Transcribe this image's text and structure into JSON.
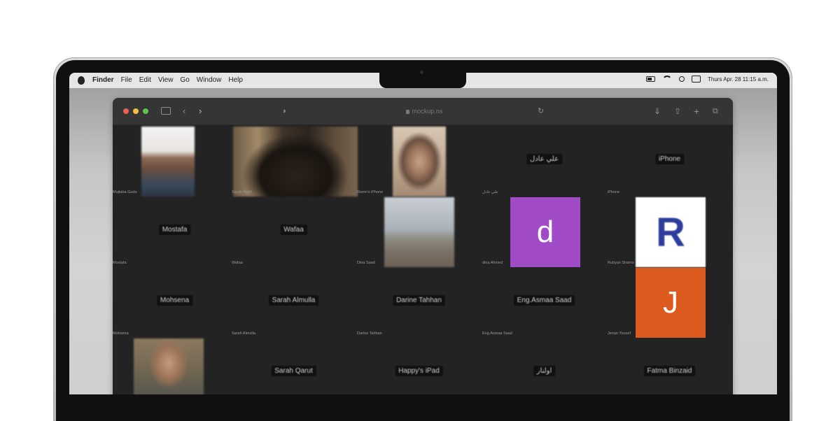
{
  "menubar": {
    "app": "Finder",
    "items": [
      "File",
      "Edit",
      "View",
      "Go",
      "Window",
      "Help"
    ],
    "clock": "Thurs Apr. 28 11:15 a.m."
  },
  "browser": {
    "url": "mockup.ns",
    "traffic_lights": [
      "#ec5f57",
      "#f2bd42",
      "#5fc351"
    ]
  },
  "grid": {
    "row1": [
      {
        "caption": "Mujtaba Guda",
        "name": ""
      },
      {
        "caption": "Sarah Nabil",
        "name": ""
      },
      {
        "caption": "Reem's iPhone",
        "name": ""
      },
      {
        "caption": "علي عادل",
        "name": "علي عادل"
      },
      {
        "caption": "iPhone",
        "name": "iPhone"
      }
    ],
    "row2": [
      {
        "caption": "Mostafa",
        "name": "Mostafa"
      },
      {
        "caption": "Wafaa",
        "name": "Wafaa"
      },
      {
        "caption": "Dina Saad",
        "name": ""
      },
      {
        "caption": "dina Ahmed",
        "name": ""
      },
      {
        "caption": "Rubyan Shams",
        "name": ""
      }
    ],
    "row3": [
      {
        "caption": "Mohsena",
        "name": "Mohsena"
      },
      {
        "caption": "Sarah Almulla",
        "name": "Sarah Almulla"
      },
      {
        "caption": "Darine Tahhan",
        "name": "Darine Tahhan"
      },
      {
        "caption": "Eng.Asmaa Saad",
        "name": "Eng.Asmaa Saad"
      },
      {
        "caption": "Jenan Yousef",
        "name": ""
      }
    ],
    "row4": [
      {
        "caption": "",
        "name": ""
      },
      {
        "caption": "",
        "name": "Sarah Qarut"
      },
      {
        "caption": "",
        "name": "Happy's iPad"
      },
      {
        "caption": "",
        "name": "اولنار"
      },
      {
        "caption": "",
        "name": "Fatma Binzaid"
      }
    ],
    "avatars": {
      "d": {
        "letter": "d",
        "color": "#a24bc6"
      },
      "j": {
        "letter": "J",
        "color": "#dd5a1e"
      },
      "logo": {
        "letter": "R",
        "color": "#2f3d9a"
      }
    }
  }
}
